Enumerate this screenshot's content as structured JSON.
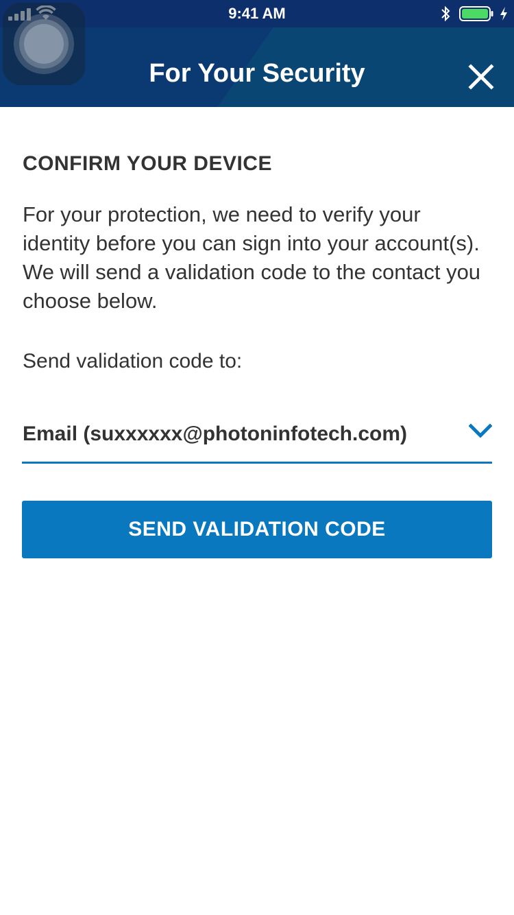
{
  "status_bar": {
    "time": "9:41 AM",
    "icons": [
      "signal-icon",
      "wifi-icon",
      "bluetooth-icon",
      "battery-icon",
      "charging-icon"
    ],
    "battery_color": "#4cd964"
  },
  "header": {
    "title": "For Your Security",
    "close_icon": "close-icon",
    "background": "#0b3a72"
  },
  "content": {
    "section_title": "CONFIRM YOUR DEVICE",
    "description": "For your protection, we need to verify your identity before you can sign into your account(s). We will send a validation code to the contact you choose below.",
    "send_to_label": "Send validation code to:",
    "contact_select": {
      "selected": "Email (suxxxxxx@photoninfotech.com)",
      "icon": "chevron-down-icon"
    },
    "send_button_label": "SEND VALIDATION CODE"
  },
  "colors": {
    "accent": "#0a78be",
    "text": "#333333",
    "header": "#0b3a72"
  }
}
